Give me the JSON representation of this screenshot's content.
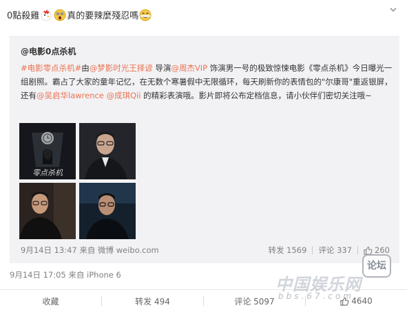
{
  "post": {
    "text_part1": "0點殺雞",
    "text_part2": "真的要辣麼殘忍嗎",
    "emojis": [
      "chicken-icon",
      "shocked-face-icon",
      "laughing-face-icon"
    ]
  },
  "quoted": {
    "author": "@电影0点杀机",
    "text": {
      "hashtag": "#电影零点杀机#",
      "t1": "由",
      "mention_director": "@梦影时光王择谚",
      "t2": " 导演",
      "mention_actor": "@周杰VIP",
      "t3": " 饰演男一号的极致惊悚电影《零点杀机》今日曝光一组剧照。霸占了大家的童年记忆，在无数个寒暑假中无限循环，每天刷新你的表情包的\"尔康哥\"重返银屏，还有",
      "mention_actor2": "@吴启华lawrence",
      "t4": " ",
      "mention_actress": "@成琪Qii",
      "t5": " 的精彩表演哦。影片即将公布定档信息，请小伙伴们密切关注哦~"
    },
    "images": [
      "poster-image",
      "actor-photo-1",
      "actor-photo-2",
      "actor-photo-3"
    ],
    "meta_date": "9月14日 13:47 来自 微博 weibo.com",
    "repost": "转发 1569",
    "comment": "评论 337",
    "likes": "260"
  },
  "meta": "9月14日 17:05 来自 iPhone 6",
  "actions": {
    "favorite": "收藏",
    "repost": "转发 494",
    "comment": "评论 5097",
    "likes": "4640"
  },
  "watermark": {
    "main": "中国娱乐网",
    "url": "bbs.67.com",
    "badge": "论坛"
  },
  "colors": {
    "link": "#eb7350",
    "quote_bg": "#f2f2f5",
    "meta": "#808080"
  }
}
